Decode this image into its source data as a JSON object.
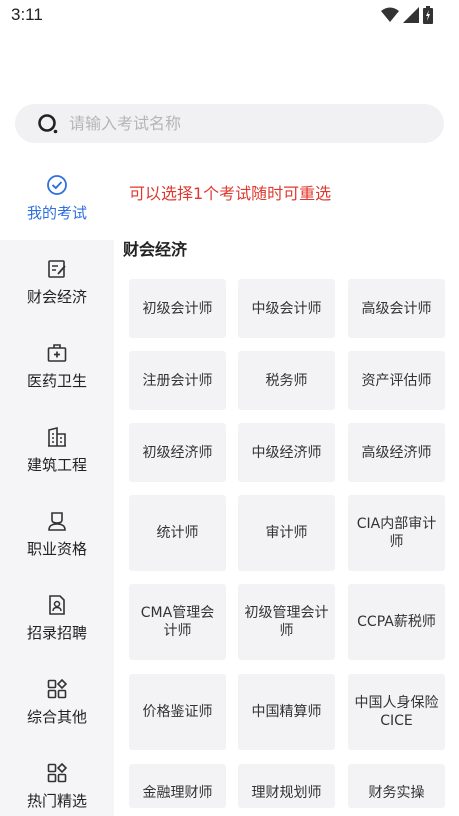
{
  "status_bar": {
    "time": "3:11"
  },
  "search": {
    "placeholder": "请输入考试名称"
  },
  "sidebar": {
    "items": [
      {
        "label": "我的考试",
        "icon": "check-circle-icon",
        "active": true
      },
      {
        "label": "财会经济",
        "icon": "edit-note-icon"
      },
      {
        "label": "医药卫生",
        "icon": "medical-kit-icon"
      },
      {
        "label": "建筑工程",
        "icon": "building-icon"
      },
      {
        "label": "职业资格",
        "icon": "professional-person-icon"
      },
      {
        "label": "招录招聘",
        "icon": "recruit-document-icon"
      },
      {
        "label": "综合其他",
        "icon": "grid-apps-icon"
      },
      {
        "label": "热门精选",
        "icon": "grid-apps-icon"
      }
    ]
  },
  "main": {
    "notice": "可以选择1个考试随时可重选",
    "section_title": "财会经济",
    "exams": [
      "初级会计师",
      "中级会计师",
      "高级会计师",
      "注册会计师",
      "税务师",
      "资产评估师",
      "初级经济师",
      "中级经济师",
      "高级经济师",
      "统计师",
      "审计师",
      "CIA内部审计师",
      "CMA管理会计师",
      "初级管理会计师",
      "CCPA薪税师",
      "价格鉴证师",
      "中国精算师",
      "中国人身保险CICE",
      "金融理财师",
      "理财规划师",
      "财务实操"
    ]
  },
  "colors": {
    "accent": "#2f6fe0",
    "notice": "#e0382e",
    "sidebar_bg": "#f5f5f7",
    "tile_bg": "#f3f3f5"
  }
}
